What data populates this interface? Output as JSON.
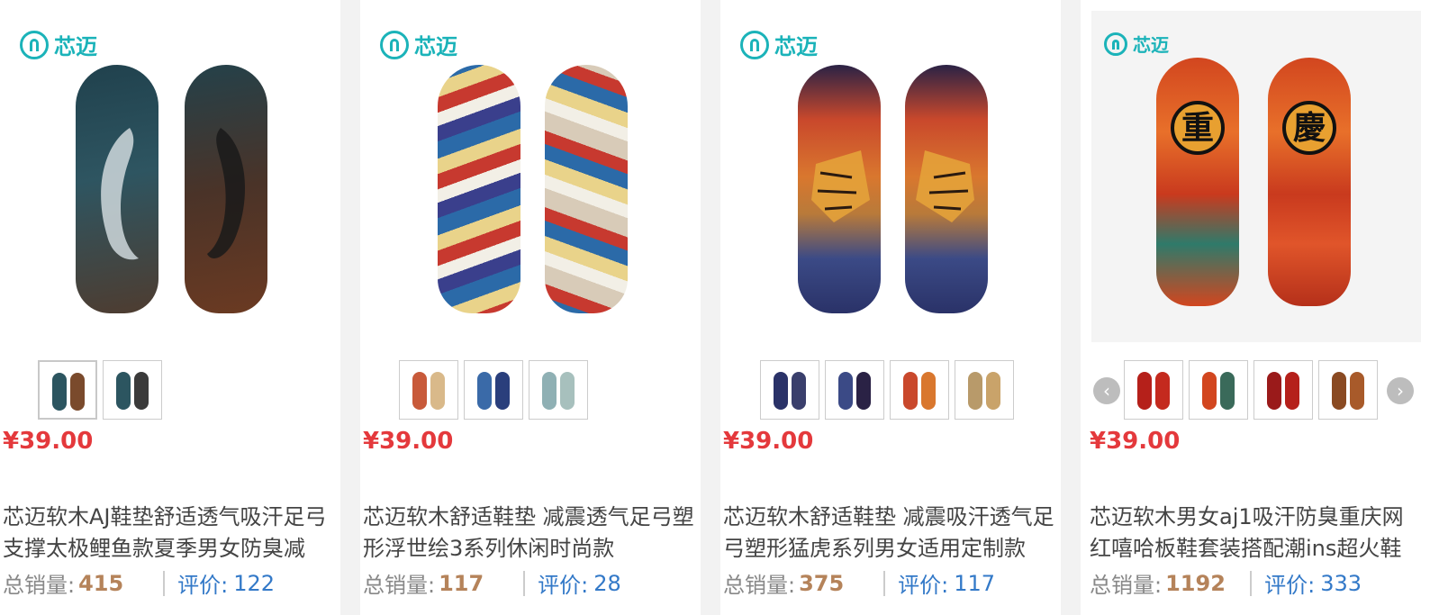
{
  "brand": {
    "name": "芯迈"
  },
  "products": [
    {
      "price": "¥39.00",
      "title": "芯迈软木AJ鞋垫舒适透气吸汗足弓支撑太极鲤鱼款夏季男女防臭减",
      "sales_label": "总销量:",
      "sales_value": "415",
      "review_label": "评价:",
      "review_value": "122",
      "thumbnail_count": 2
    },
    {
      "price": "¥39.00",
      "title": "芯迈软木舒适鞋垫 减震透气足弓塑形浮世绘3系列休闲时尚款",
      "sales_label": "总销量:",
      "sales_value": "117",
      "review_label": "评价:",
      "review_value": "28",
      "thumbnail_count": 3
    },
    {
      "price": "¥39.00",
      "title": "芯迈软木舒适鞋垫 减震吸汗透气足弓塑形猛虎系列男女适用定制款",
      "sales_label": "总销量:",
      "sales_value": "375",
      "review_label": "评价:",
      "review_value": "117",
      "thumbnail_count": 4
    },
    {
      "price": "¥39.00",
      "title": "芯迈软木男女aj1吸汗防臭重庆网红嘻哈板鞋套装搭配潮ins超火鞋",
      "sales_label": "总销量:",
      "sales_value": "1192",
      "review_label": "评价:",
      "review_value": "333",
      "seal_left": "重",
      "seal_right": "慶",
      "thumbnail_count": 4
    }
  ],
  "nav": {
    "prev_icon": "‹",
    "next_icon": "›"
  },
  "colors": {
    "price": "#e4393c",
    "brand": "#1bb3b9",
    "sales": "#b5835a",
    "review": "#3379c8"
  }
}
